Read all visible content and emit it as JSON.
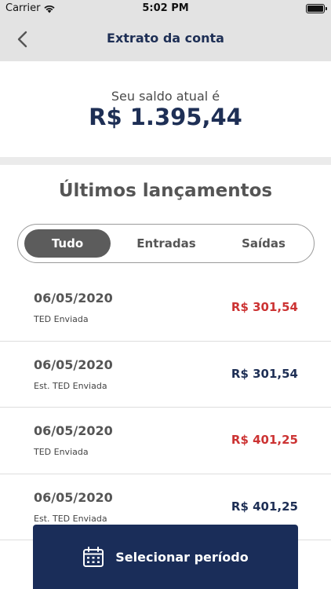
{
  "status_bar": {
    "carrier": "Carrier",
    "time": "5:02 PM"
  },
  "nav": {
    "title": "Extrato da conta"
  },
  "balance": {
    "label": "Seu saldo atual é",
    "value": "R$ 1.395,44"
  },
  "section": {
    "title": "Últimos lançamentos"
  },
  "filters": {
    "tabs": [
      {
        "label": "Tudo",
        "active": true
      },
      {
        "label": "Entradas",
        "active": false
      },
      {
        "label": "Saídas",
        "active": false
      }
    ]
  },
  "transactions": [
    {
      "date": "06/05/2020",
      "description": "TED Enviada",
      "amount": "R$ 301,54",
      "type": "out"
    },
    {
      "date": "06/05/2020",
      "description": "Est. TED Enviada",
      "amount": "R$ 301,54",
      "type": "in"
    },
    {
      "date": "06/05/2020",
      "description": "TED Enviada",
      "amount": "R$ 401,25",
      "type": "out"
    },
    {
      "date": "06/05/2020",
      "description": "Est. TED Enviada",
      "amount": "R$ 401,25",
      "type": "in"
    }
  ],
  "period_button": {
    "label": "Selecionar período"
  },
  "colors": {
    "primary": "#1a2d59",
    "debit": "#cc3333",
    "credit": "#1e2f55"
  }
}
